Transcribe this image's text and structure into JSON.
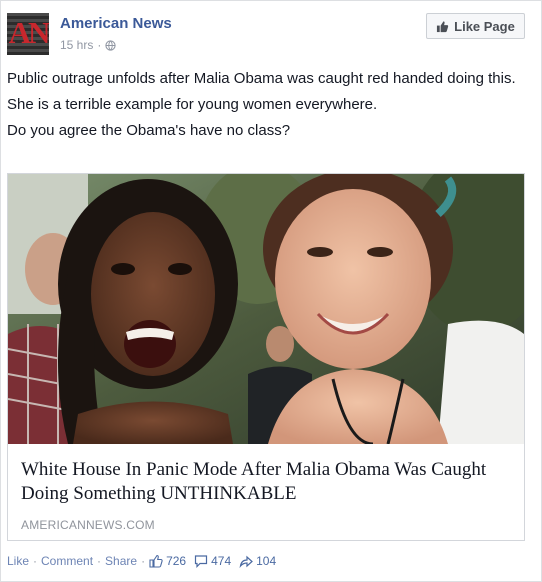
{
  "header": {
    "avatar_text": "AN",
    "page_name": "American News",
    "time": "15 hrs",
    "dot": "·",
    "like_page_label": "Like Page"
  },
  "post": {
    "lines": [
      "Public outrage unfolds after Malia Obama was caught red handed doing this.",
      "She is a terrible example for young women everywhere.",
      "Do you agree the Obama's have no class?"
    ]
  },
  "card": {
    "title": "White House In Panic Mode After Malia Obama Was Caught Doing Something UNTHINKABLE",
    "domain": "AMERICANNEWS.COM"
  },
  "footer": {
    "like": "Like",
    "comment": "Comment",
    "share": "Share",
    "separator": "·",
    "likes_count": "726",
    "comments_count": "474",
    "shares_count": "104"
  },
  "colors": {
    "link_blue": "#3b5998",
    "muted": "#9197a3",
    "brand_red": "#c8272d"
  }
}
